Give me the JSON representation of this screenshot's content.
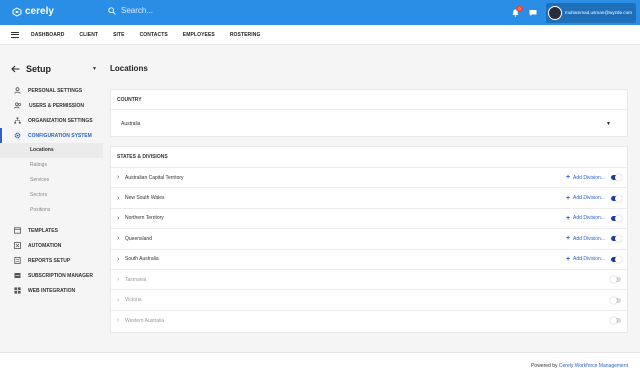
{
  "app": {
    "logo_text": "cerely",
    "brand_color": "#2a8de6"
  },
  "search": {
    "placeholder": "Search..."
  },
  "notifications": {
    "count": "0"
  },
  "user": {
    "email": "muhammad.usman@wyzde.com"
  },
  "nav": {
    "items": [
      "DASHBOARD",
      "CLIENT",
      "SITE",
      "CONTACTS",
      "EMPLOYEES",
      "ROSTERING"
    ]
  },
  "sidebar": {
    "title": "Setup",
    "items": [
      {
        "label": "PERSONAL SETTINGS",
        "icon": "user-icon"
      },
      {
        "label": "USERS & PERMISSION",
        "icon": "users-icon"
      },
      {
        "label": "ORGANIZATION SETTINGS",
        "icon": "org-chart-icon"
      },
      {
        "label": "CONFIGURATION SYSTEM",
        "icon": "gear-icon"
      },
      {
        "label": "TEMPLATES",
        "icon": "template-icon"
      },
      {
        "label": "AUTOMATION",
        "icon": "automation-icon"
      },
      {
        "label": "REPORTS SETUP",
        "icon": "report-icon"
      },
      {
        "label": "SUBSCRIPTION MANAGER",
        "icon": "subscription-icon"
      },
      {
        "label": "WEB INTEGRATION",
        "icon": "grid-icon"
      }
    ],
    "sub_items": [
      "Locations",
      "Ratings",
      "Services",
      "Sectors",
      "Positions"
    ]
  },
  "main": {
    "title": "Locations",
    "country": {
      "header": "COUNTRY",
      "value": "Australia"
    },
    "states": {
      "header": "STATES & DIVISIONS",
      "add_label": "Add Division...",
      "rows": [
        {
          "name": "Australian Capital Territory",
          "enabled": true
        },
        {
          "name": "New South Wales",
          "enabled": true
        },
        {
          "name": "Northern Territory",
          "enabled": true
        },
        {
          "name": "Queensland",
          "enabled": true
        },
        {
          "name": "South Australia",
          "enabled": true
        },
        {
          "name": "Tasmania",
          "enabled": false
        },
        {
          "name": "Victoria",
          "enabled": false
        },
        {
          "name": "Western Australia",
          "enabled": false
        }
      ]
    }
  },
  "footer": {
    "prefix": "Powered by",
    "brand": "Cerely Workforce Management"
  }
}
